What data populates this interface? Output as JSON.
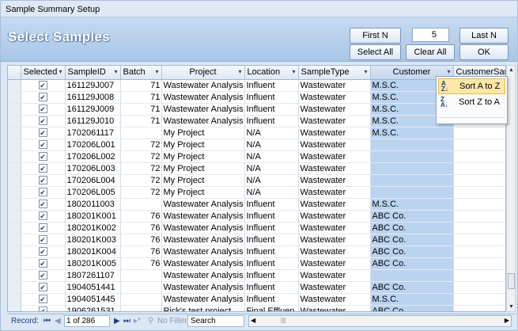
{
  "window": {
    "title": "Sample Summary Setup"
  },
  "header": {
    "title": "Select Samples",
    "first_n_label": "First N",
    "n_value": "5",
    "last_n_label": "Last N",
    "select_all_label": "Select All",
    "clear_all_label": "Clear All",
    "ok_label": "OK"
  },
  "grid": {
    "columns": [
      "Selected",
      "SampleID",
      "Batch",
      "Project",
      "Location",
      "SampleType",
      "Customer",
      "CustomerSam"
    ],
    "rows": [
      {
        "checked": true,
        "sample_id": "161129J007",
        "batch": "71",
        "project": "Wastewater Analysis",
        "location": "Influent",
        "sample_type": "Wastewater",
        "customer": "M.S.C."
      },
      {
        "checked": true,
        "sample_id": "161129J008",
        "batch": "71",
        "project": "Wastewater Analysis",
        "location": "Influent",
        "sample_type": "Wastewater",
        "customer": "M.S.C."
      },
      {
        "checked": true,
        "sample_id": "161129J009",
        "batch": "71",
        "project": "Wastewater Analysis",
        "location": "Influent",
        "sample_type": "Wastewater",
        "customer": "M.S.C."
      },
      {
        "checked": true,
        "sample_id": "161129J010",
        "batch": "71",
        "project": "Wastewater Analysis",
        "location": "Influent",
        "sample_type": "Wastewater",
        "customer": "M.S.C."
      },
      {
        "checked": true,
        "sample_id": "1702061117",
        "batch": "",
        "project": "My Project",
        "location": "N/A",
        "sample_type": "Wastewater",
        "customer": "M.S.C."
      },
      {
        "checked": true,
        "sample_id": "170206L001",
        "batch": "72",
        "project": "My Project",
        "location": "N/A",
        "sample_type": "Wastewater",
        "customer": ""
      },
      {
        "checked": true,
        "sample_id": "170206L002",
        "batch": "72",
        "project": "My Project",
        "location": "N/A",
        "sample_type": "Wastewater",
        "customer": ""
      },
      {
        "checked": true,
        "sample_id": "170206L003",
        "batch": "72",
        "project": "My Project",
        "location": "N/A",
        "sample_type": "Wastewater",
        "customer": ""
      },
      {
        "checked": true,
        "sample_id": "170206L004",
        "batch": "72",
        "project": "My Project",
        "location": "N/A",
        "sample_type": "Wastewater",
        "customer": ""
      },
      {
        "checked": true,
        "sample_id": "170206L005",
        "batch": "72",
        "project": "My Project",
        "location": "N/A",
        "sample_type": "Wastewater",
        "customer": ""
      },
      {
        "checked": true,
        "sample_id": "1802011003",
        "batch": "",
        "project": "Wastewater Analysis",
        "location": "Influent",
        "sample_type": "Wastewater",
        "customer": "M.S.C."
      },
      {
        "checked": true,
        "sample_id": "180201K001",
        "batch": "76",
        "project": "Wastewater Analysis",
        "location": "Influent",
        "sample_type": "Wastewater",
        "customer": "ABC Co."
      },
      {
        "checked": true,
        "sample_id": "180201K002",
        "batch": "76",
        "project": "Wastewater Analysis",
        "location": "Influent",
        "sample_type": "Wastewater",
        "customer": "ABC Co."
      },
      {
        "checked": true,
        "sample_id": "180201K003",
        "batch": "76",
        "project": "Wastewater Analysis",
        "location": "Influent",
        "sample_type": "Wastewater",
        "customer": "ABC Co."
      },
      {
        "checked": true,
        "sample_id": "180201K004",
        "batch": "76",
        "project": "Wastewater Analysis",
        "location": "Influent",
        "sample_type": "Wastewater",
        "customer": "ABC Co."
      },
      {
        "checked": true,
        "sample_id": "180201K005",
        "batch": "76",
        "project": "Wastewater Analysis",
        "location": "Influent",
        "sample_type": "Wastewater",
        "customer": "ABC Co."
      },
      {
        "checked": true,
        "sample_id": "1807261107",
        "batch": "",
        "project": "Wastewater Analysis",
        "location": "Influent",
        "sample_type": "Wastewater",
        "customer": ""
      },
      {
        "checked": true,
        "sample_id": "1904051441",
        "batch": "",
        "project": "Wastewater Analysis",
        "location": "Influent",
        "sample_type": "Wastewater",
        "customer": "ABC Co."
      },
      {
        "checked": true,
        "sample_id": "1904051445",
        "batch": "",
        "project": "Wastewater Analysis",
        "location": "Influent",
        "sample_type": "Wastewater",
        "customer": "M.S.C."
      },
      {
        "checked": true,
        "sample_id": "1906261531",
        "batch": "",
        "project": "Rick's test project",
        "location": "Final Effluen",
        "sample_type": "Wastewater",
        "customer": "ABC Co."
      }
    ]
  },
  "sort_menu": {
    "sort_az": "Sort A to Z",
    "sort_za": "Sort Z to A"
  },
  "status_bar": {
    "record_label": "Record:",
    "position": "1 of 286",
    "filter_label": "No Filter",
    "search_placeholder": "Search"
  }
}
